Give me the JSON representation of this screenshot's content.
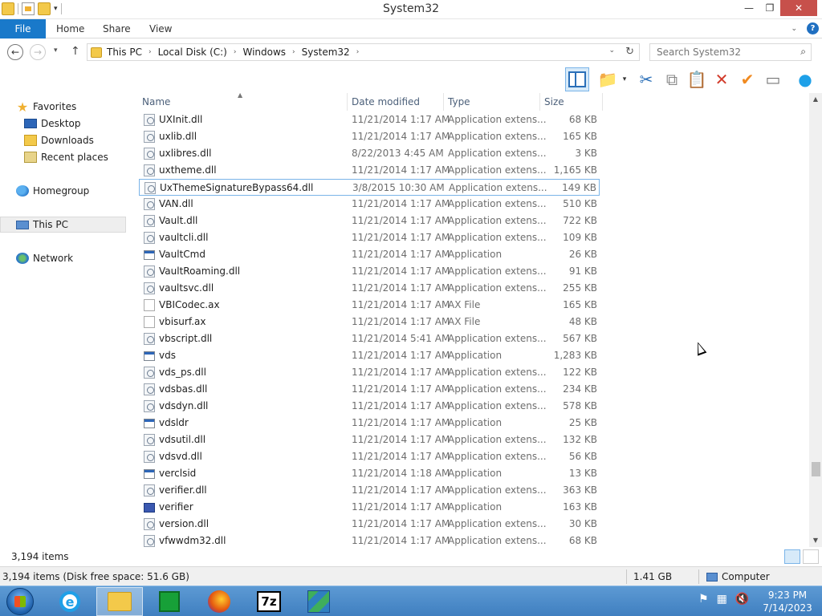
{
  "window": {
    "title": "System32"
  },
  "ribbon": {
    "file": "File",
    "tabs": [
      "Home",
      "Share",
      "View"
    ],
    "help": "?"
  },
  "nav": {
    "breadcrumbs": [
      "This PC",
      "Local Disk (C:)",
      "Windows",
      "System32"
    ],
    "search_placeholder": "Search System32"
  },
  "sidebar": {
    "favorites": "Favorites",
    "desktop": "Desktop",
    "downloads": "Downloads",
    "recent": "Recent places",
    "homegroup": "Homegroup",
    "thispc": "This PC",
    "network": "Network"
  },
  "columns": {
    "name": "Name",
    "date": "Date modified",
    "type": "Type",
    "size": "Size"
  },
  "files": [
    {
      "name": "UXInit.dll",
      "date": "11/21/2014 1:17 AM",
      "type": "Application extens...",
      "size": "68 KB",
      "icon": "dll"
    },
    {
      "name": "uxlib.dll",
      "date": "11/21/2014 1:17 AM",
      "type": "Application extens...",
      "size": "165 KB",
      "icon": "dll"
    },
    {
      "name": "uxlibres.dll",
      "date": "8/22/2013 4:45 AM",
      "type": "Application extens...",
      "size": "3 KB",
      "icon": "dll"
    },
    {
      "name": "uxtheme.dll",
      "date": "11/21/2014 1:17 AM",
      "type": "Application extens...",
      "size": "1,165 KB",
      "icon": "dll"
    },
    {
      "name": "UxThemeSignatureBypass64.dll",
      "date": "3/8/2015 10:30 AM",
      "type": "Application extens...",
      "size": "149 KB",
      "icon": "dll",
      "selected": true
    },
    {
      "name": "VAN.dll",
      "date": "11/21/2014 1:17 AM",
      "type": "Application extens...",
      "size": "510 KB",
      "icon": "dll"
    },
    {
      "name": "Vault.dll",
      "date": "11/21/2014 1:17 AM",
      "type": "Application extens...",
      "size": "722 KB",
      "icon": "dll"
    },
    {
      "name": "vaultcli.dll",
      "date": "11/21/2014 1:17 AM",
      "type": "Application extens...",
      "size": "109 KB",
      "icon": "dll"
    },
    {
      "name": "VaultCmd",
      "date": "11/21/2014 1:17 AM",
      "type": "Application",
      "size": "26 KB",
      "icon": "app"
    },
    {
      "name": "VaultRoaming.dll",
      "date": "11/21/2014 1:17 AM",
      "type": "Application extens...",
      "size": "91 KB",
      "icon": "dll"
    },
    {
      "name": "vaultsvc.dll",
      "date": "11/21/2014 1:17 AM",
      "type": "Application extens...",
      "size": "255 KB",
      "icon": "dll"
    },
    {
      "name": "VBICodec.ax",
      "date": "11/21/2014 1:17 AM",
      "type": "AX File",
      "size": "165 KB",
      "icon": "ax"
    },
    {
      "name": "vbisurf.ax",
      "date": "11/21/2014 1:17 AM",
      "type": "AX File",
      "size": "48 KB",
      "icon": "ax"
    },
    {
      "name": "vbscript.dll",
      "date": "11/21/2014 5:41 AM",
      "type": "Application extens...",
      "size": "567 KB",
      "icon": "dll"
    },
    {
      "name": "vds",
      "date": "11/21/2014 1:17 AM",
      "type": "Application",
      "size": "1,283 KB",
      "icon": "app"
    },
    {
      "name": "vds_ps.dll",
      "date": "11/21/2014 1:17 AM",
      "type": "Application extens...",
      "size": "122 KB",
      "icon": "dll"
    },
    {
      "name": "vdsbas.dll",
      "date": "11/21/2014 1:17 AM",
      "type": "Application extens...",
      "size": "234 KB",
      "icon": "dll"
    },
    {
      "name": "vdsdyn.dll",
      "date": "11/21/2014 1:17 AM",
      "type": "Application extens...",
      "size": "578 KB",
      "icon": "dll"
    },
    {
      "name": "vdsldr",
      "date": "11/21/2014 1:17 AM",
      "type": "Application",
      "size": "25 KB",
      "icon": "app"
    },
    {
      "name": "vdsutil.dll",
      "date": "11/21/2014 1:17 AM",
      "type": "Application extens...",
      "size": "132 KB",
      "icon": "dll"
    },
    {
      "name": "vdsvd.dll",
      "date": "11/21/2014 1:17 AM",
      "type": "Application extens...",
      "size": "56 KB",
      "icon": "dll"
    },
    {
      "name": "verclsid",
      "date": "11/21/2014 1:18 AM",
      "type": "Application",
      "size": "13 KB",
      "icon": "app"
    },
    {
      "name": "verifier.dll",
      "date": "11/21/2014 1:17 AM",
      "type": "Application extens...",
      "size": "363 KB",
      "icon": "dll"
    },
    {
      "name": "verifier",
      "date": "11/21/2014 1:17 AM",
      "type": "Application",
      "size": "163 KB",
      "icon": "verifier"
    },
    {
      "name": "version.dll",
      "date": "11/21/2014 1:17 AM",
      "type": "Application extens...",
      "size": "30 KB",
      "icon": "dll"
    },
    {
      "name": "vfwwdm32.dll",
      "date": "11/21/2014 1:17 AM",
      "type": "Application extens...",
      "size": "68 KB",
      "icon": "dll"
    }
  ],
  "footer": {
    "item_count": "3,194 items",
    "status": "3,194 items (Disk free space: 51.6 GB)",
    "size": "1.41 GB",
    "location": "Computer"
  },
  "taskbar": {
    "time": "9:23 PM",
    "date": "7/14/2023",
    "sevenzip": "7z"
  }
}
